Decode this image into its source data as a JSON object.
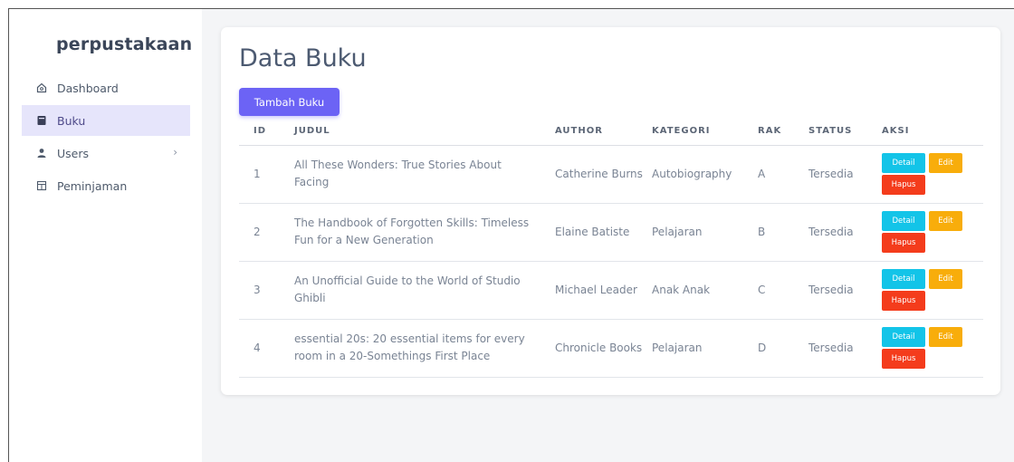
{
  "sidebar": {
    "brand": "perpustakaan",
    "items": [
      {
        "label": "Dashboard",
        "icon": "home-icon",
        "active": false
      },
      {
        "label": "Buku",
        "icon": "book-icon",
        "active": true
      },
      {
        "label": "Users",
        "icon": "user-icon",
        "active": false,
        "chevron": "›"
      },
      {
        "label": "Peminjaman",
        "icon": "table-icon",
        "active": false
      }
    ]
  },
  "main": {
    "title": "Data Buku",
    "add_button": "Tambah Buku",
    "columns": [
      "ID",
      "JUDUL",
      "AUTHOR",
      "KATEGORI",
      "RAK",
      "STATUS",
      "AKSI"
    ],
    "rows": [
      {
        "id": "1",
        "judul": "All These Wonders: True Stories About Facing",
        "author": "Catherine Burns",
        "kategori": "Autobiography",
        "rak": "A",
        "status": "Tersedia"
      },
      {
        "id": "2",
        "judul": "The Handbook of Forgotten Skills: Timeless Fun for a New Generation",
        "author": "Elaine Batiste",
        "kategori": "Pelajaran",
        "rak": "B",
        "status": "Tersedia"
      },
      {
        "id": "3",
        "judul": "An Unofficial Guide to the World of Studio Ghibli",
        "author": "Michael Leader",
        "kategori": "Anak Anak",
        "rak": "C",
        "status": "Tersedia"
      },
      {
        "id": "4",
        "judul": "essential 20s: 20 essential items for every room in a 20-Somethings First Place",
        "author": "Chronicle Books",
        "kategori": "Pelajaran",
        "rak": "D",
        "status": "Tersedia"
      }
    ],
    "actions": {
      "detail": "Detail",
      "edit": "Edit",
      "hapus": "Hapus"
    }
  },
  "colors": {
    "accent": "#6c63f5",
    "detail": "#13c4e8",
    "edit": "#f8ad0b",
    "hapus": "#f43c1c",
    "active_bg": "#e6e5fb"
  }
}
